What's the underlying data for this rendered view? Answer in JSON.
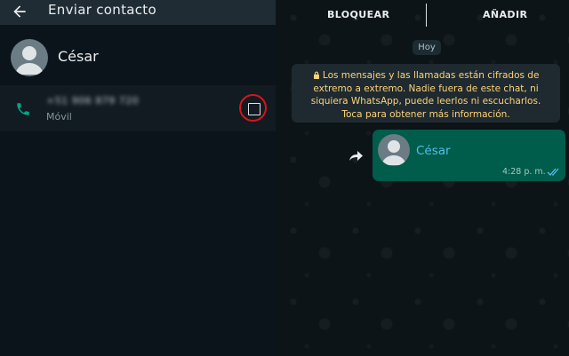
{
  "header": {
    "title": "Enviar contacto"
  },
  "contact": {
    "name": "César",
    "phone": "+51 906 879 720",
    "phone_type": "Móvil"
  },
  "chat": {
    "block_label": "BLOQUEAR",
    "add_label": "AÑADIR",
    "date_label": "Hoy",
    "encryption_notice": "Los mensajes y las llamadas están cifrados de extremo a extremo. Nadie fuera de este chat, ni siquiera WhatsApp, puede leerlos ni escucharlos. Toca para obtener más información.",
    "message": {
      "contact_name": "César",
      "time": "4:28 p. m."
    }
  },
  "colors": {
    "highlight_circle": "#d7141a",
    "bubble": "#005c4b",
    "notice_text": "#ffd279",
    "link_name": "#53bdeb"
  },
  "icons": {
    "back": "arrow-left-icon",
    "avatar": "person-icon",
    "phone": "phone-icon",
    "lock": "lock-icon",
    "forward": "forward-icon",
    "ticks": "double-check-icon"
  }
}
